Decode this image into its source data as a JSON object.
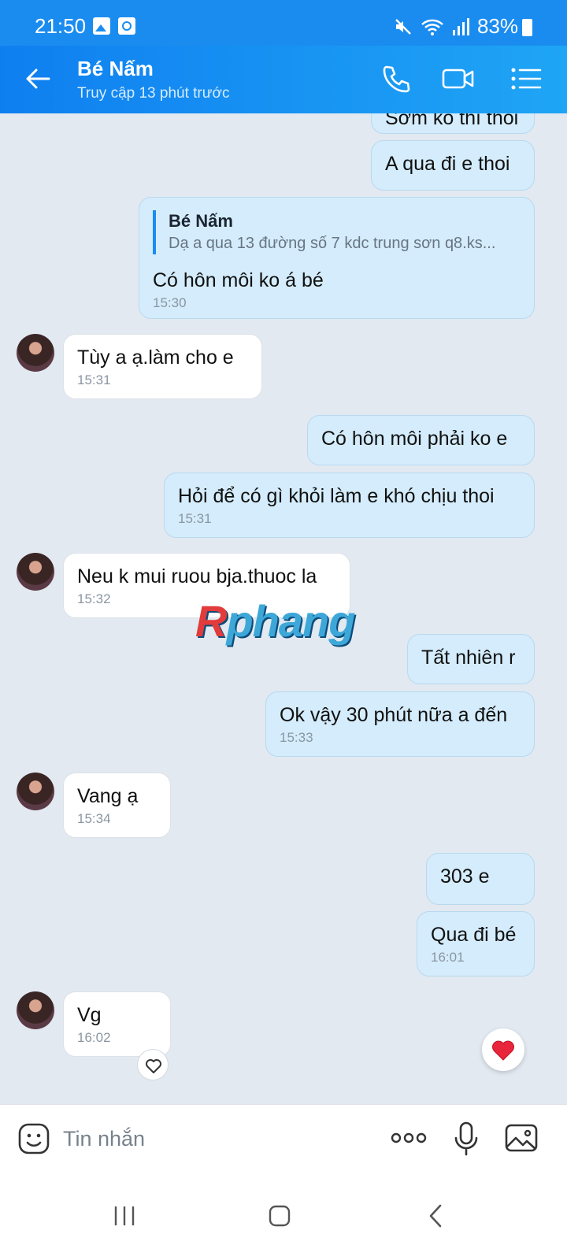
{
  "status_bar": {
    "time": "21:50",
    "battery": "83%"
  },
  "header": {
    "name": "Bé Nấm",
    "status": "Truy cập 13 phút trước"
  },
  "messages": [
    {
      "text": "Sớm ko thì thoi"
    },
    {
      "text": "A qua đi e thoi"
    },
    {
      "quote_name": "Bé Nấm",
      "quote_text": "Dạ a qua 13 đường số 7 kdc trung sơn q8.ks...",
      "text": "Có hôn môi ko á bé",
      "time": "15:30"
    },
    {
      "text": "Tùy a ạ.làm cho e",
      "time": "15:31"
    },
    {
      "text": "Có hôn môi phải ko e"
    },
    {
      "text": "Hỏi để có gì khỏi làm e khó chịu thoi",
      "time": "15:31"
    },
    {
      "text": "Neu k mui ruou bja.thuoc la",
      "time": "15:32"
    },
    {
      "text": "Tất nhiên r"
    },
    {
      "text": "Ok vậy 30 phút nữa a đến",
      "time": "15:33"
    },
    {
      "text": "Vang ạ",
      "time": "15:34"
    },
    {
      "text": "303 e"
    },
    {
      "text": "Qua đi bé",
      "time": "16:01"
    },
    {
      "text": "Vg",
      "time": "16:02"
    }
  ],
  "watermark": {
    "first": "R",
    "rest": "phang"
  },
  "composer": {
    "placeholder": "Tin nhắn"
  },
  "icons": {
    "back": "arrow-left-icon",
    "call": "phone-icon",
    "video": "video-camera-icon",
    "menu": "list-menu-icon",
    "emoji": "sticker-icon",
    "more": "more-dots-icon",
    "mic": "microphone-icon",
    "gallery": "image-icon",
    "like": "heart-icon"
  },
  "colors": {
    "header": "#1a8cf0",
    "outgoing_bubble": "#d4ecfb",
    "incoming_bubble": "#ffffff",
    "chat_bg": "#e2e9f1",
    "heart": "#e8253a"
  }
}
